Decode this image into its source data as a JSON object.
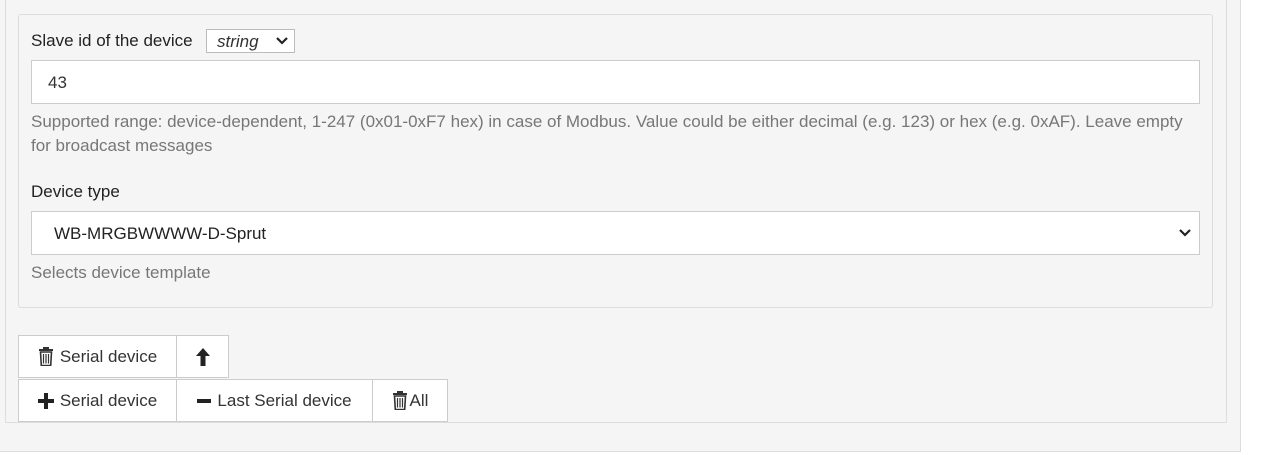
{
  "slave_id": {
    "label": "Slave id of the device",
    "type_selector_value": "string",
    "value": "43",
    "help": "Supported range: device-dependent, 1-247 (0x01-0xF7 hex) in case of Modbus. Value could be either decimal (e.g. 123) or hex (e.g. 0xAF). Leave empty for broadcast messages"
  },
  "device_type": {
    "label": "Device type",
    "selected": "WB-MRGBWWWW-D-Sprut",
    "help": "Selects device template"
  },
  "item_buttons": {
    "delete_label": "Serial device",
    "delete_icon": "trash-icon",
    "move_up_icon": "arrow-up-icon"
  },
  "array_buttons": {
    "add_label": "Serial device",
    "add_icon": "plus-icon",
    "remove_last_label": "Last Serial device",
    "remove_last_icon": "minus-icon",
    "delete_all_label": "All",
    "delete_all_icon": "trash-icon"
  }
}
